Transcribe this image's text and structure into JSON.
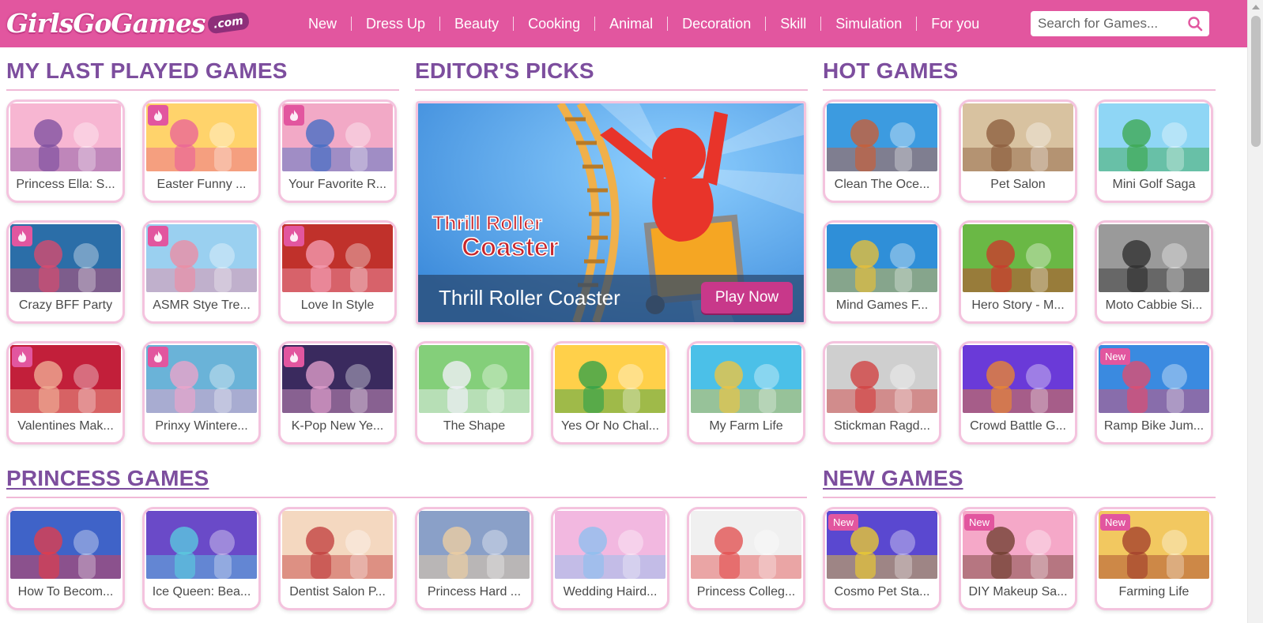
{
  "site": {
    "logo_text": "GirlsGoGames",
    "logo_suffix": ".com"
  },
  "nav": [
    {
      "label": "New"
    },
    {
      "label": "Dress Up"
    },
    {
      "label": "Beauty"
    },
    {
      "label": "Cooking"
    },
    {
      "label": "Animal"
    },
    {
      "label": "Decoration"
    },
    {
      "label": "Skill"
    },
    {
      "label": "Simulation"
    },
    {
      "label": "For you"
    }
  ],
  "search": {
    "placeholder": "Search for Games..."
  },
  "colors": {
    "brand": "#e2569f",
    "heading": "#7d4e9e",
    "tile_border": "#f4c3de"
  },
  "sections": {
    "last_played": {
      "title": "MY LAST PLAYED GAMES",
      "games": [
        {
          "label": "Princess Ella: S...",
          "badge": ""
        },
        {
          "label": "Easter Funny ...",
          "badge": "hot"
        },
        {
          "label": "Your Favorite R...",
          "badge": "hot"
        },
        {
          "label": "Crazy BFF Party",
          "badge": "hot"
        },
        {
          "label": "ASMR Stye Tre...",
          "badge": "hot"
        },
        {
          "label": "Love In Style",
          "badge": "hot"
        },
        {
          "label": "Valentines Mak...",
          "badge": "hot"
        },
        {
          "label": "Prinxy Wintere...",
          "badge": "hot"
        },
        {
          "label": "K-Pop New Ye...",
          "badge": "hot"
        }
      ]
    },
    "editors_picks": {
      "title": "EDITOR'S PICKS",
      "feature": {
        "title": "Thrill Roller Coaster",
        "art_title_line1": "Thrill Roller",
        "art_title_line2": "Coaster",
        "play_label": "Play Now"
      },
      "games": [
        {
          "label": "The Shape",
          "badge": ""
        },
        {
          "label": "Yes Or No Chal...",
          "badge": ""
        },
        {
          "label": "My Farm Life",
          "badge": ""
        }
      ]
    },
    "hot_games": {
      "title": "HOT GAMES",
      "games": [
        {
          "label": "Clean The Oce...",
          "badge": ""
        },
        {
          "label": "Pet Salon",
          "badge": ""
        },
        {
          "label": "Mini Golf Saga",
          "badge": ""
        },
        {
          "label": "Mind Games F...",
          "badge": ""
        },
        {
          "label": "Hero Story - M...",
          "badge": ""
        },
        {
          "label": "Moto Cabbie Si...",
          "badge": ""
        },
        {
          "label": "Stickman Ragd...",
          "badge": ""
        },
        {
          "label": "Crowd Battle G...",
          "badge": ""
        },
        {
          "label": "Ramp Bike Jum...",
          "badge": "New"
        }
      ]
    },
    "princess_games": {
      "title": "PRINCESS GAMES",
      "games": [
        {
          "label": "How To Becom...",
          "badge": ""
        },
        {
          "label": "Ice Queen: Bea...",
          "badge": ""
        },
        {
          "label": "Dentist Salon P...",
          "badge": ""
        },
        {
          "label": "Princess Hard ...",
          "badge": ""
        },
        {
          "label": "Wedding Haird...",
          "badge": ""
        },
        {
          "label": "Princess Colleg...",
          "badge": ""
        }
      ]
    },
    "new_games": {
      "title": "NEW GAMES",
      "games": [
        {
          "label": "Cosmo Pet Sta...",
          "badge": "New"
        },
        {
          "label": "DIY Makeup Sa...",
          "badge": "New"
        },
        {
          "label": "Farming Life",
          "badge": "New"
        }
      ]
    }
  }
}
